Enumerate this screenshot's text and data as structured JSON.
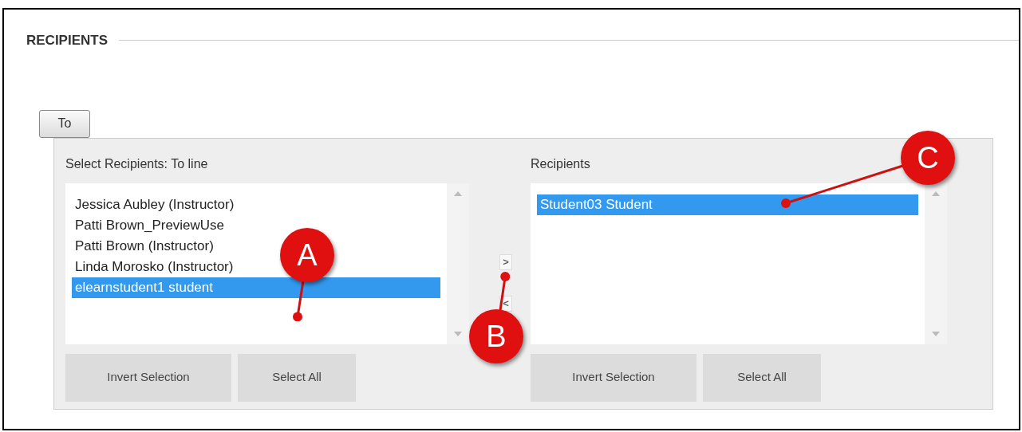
{
  "section_title": "RECIPIENTS",
  "to_button": "To",
  "available": {
    "label": "Select Recipients: To line",
    "items": [
      {
        "text": "Jessica Aubley (Instructor)",
        "selected": false
      },
      {
        "text": "Patti Brown_PreviewUse",
        "selected": false
      },
      {
        "text": "Patti Brown (Instructor)",
        "selected": false
      },
      {
        "text": "Linda Morosko (Instructor)",
        "selected": false
      },
      {
        "text": "elearnstudent1 student",
        "selected": true
      }
    ],
    "buttons": [
      "Invert Selection",
      "Select All"
    ]
  },
  "move_buttons": [
    ">",
    "<"
  ],
  "recipients": {
    "label": "Recipients",
    "items": [
      {
        "text": "Student03 Student",
        "selected": true
      }
    ],
    "buttons": [
      "Invert Selection",
      "Select All"
    ]
  },
  "callouts": [
    {
      "letter": "A"
    },
    {
      "letter": "B"
    },
    {
      "letter": "C"
    }
  ]
}
